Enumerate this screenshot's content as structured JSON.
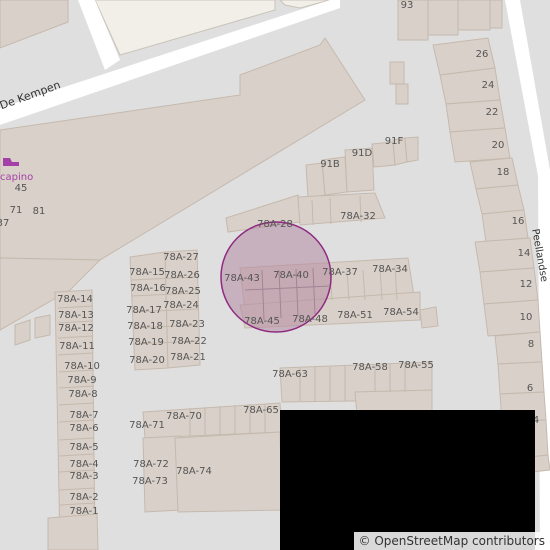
{
  "streets": {
    "de_kempen": "De Kempen",
    "right_street": "Peellandse"
  },
  "poi": {
    "name": "capino"
  },
  "house_numbers": {
    "n45": "45",
    "n71": "71",
    "n81": "81",
    "n37": "37",
    "n93": "93",
    "n26": "26",
    "n24": "24",
    "n22": "22",
    "n20": "20",
    "n18": "18",
    "n16": "16",
    "n14": "14",
    "n12": "12",
    "n10": "10",
    "n8": "8",
    "n6": "6",
    "n4": "4",
    "n91F": "91F",
    "n91D": "91D",
    "n91B": "91B",
    "a28": "78A-28",
    "a32": "78A-32",
    "a27": "78A-27",
    "a26": "78A-26",
    "a25": "78A-25",
    "a24": "78A-24",
    "a23": "78A-23",
    "a22": "78A-22",
    "a21": "78A-21",
    "a15": "78A-15",
    "a16": "78A-16",
    "a17": "78A-17",
    "a18": "78A-18",
    "a19": "78A-19",
    "a20": "78A-20",
    "a43": "78A-43",
    "a40": "78A-40",
    "a37": "78A-37",
    "a34": "78A-34",
    "a45": "78A-45",
    "a48": "78A-48",
    "a51": "78A-51",
    "a54": "78A-54",
    "a14": "78A-14",
    "a13": "78A-13",
    "a12": "78A-12",
    "a11": "78A-11",
    "a10": "78A-10",
    "a9": "78A-9",
    "a8": "78A-8",
    "a7": "78A-7",
    "a6": "78A-6",
    "a5": "78A-5",
    "a4": "78A-4",
    "a3": "78A-3",
    "a2": "78A-2",
    "a1": "78A-1",
    "a63": "78A-63",
    "a58": "78A-58",
    "a55": "78A-55",
    "a70": "78A-70",
    "a65": "78A-65",
    "a71": "78A-71",
    "a72": "78A-72",
    "a73": "78A-73",
    "a74": "78A-74"
  },
  "attribution": "© OpenStreetMap contributors",
  "marker": {
    "type": "circle-highlight",
    "fill": "#b48aa3",
    "stroke": "#8e2a80"
  }
}
